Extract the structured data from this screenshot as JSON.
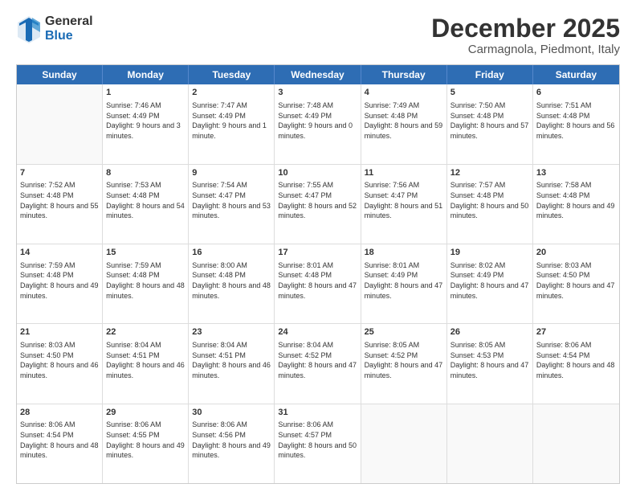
{
  "header": {
    "logo_general": "General",
    "logo_blue": "Blue",
    "month": "December 2025",
    "location": "Carmagnola, Piedmont, Italy"
  },
  "days_of_week": [
    "Sunday",
    "Monday",
    "Tuesday",
    "Wednesday",
    "Thursday",
    "Friday",
    "Saturday"
  ],
  "rows": [
    [
      {
        "day": "",
        "sunrise": "",
        "sunset": "",
        "daylight": "",
        "empty": true
      },
      {
        "day": "1",
        "sunrise": "Sunrise: 7:46 AM",
        "sunset": "Sunset: 4:49 PM",
        "daylight": "Daylight: 9 hours and 3 minutes."
      },
      {
        "day": "2",
        "sunrise": "Sunrise: 7:47 AM",
        "sunset": "Sunset: 4:49 PM",
        "daylight": "Daylight: 9 hours and 1 minute."
      },
      {
        "day": "3",
        "sunrise": "Sunrise: 7:48 AM",
        "sunset": "Sunset: 4:49 PM",
        "daylight": "Daylight: 9 hours and 0 minutes."
      },
      {
        "day": "4",
        "sunrise": "Sunrise: 7:49 AM",
        "sunset": "Sunset: 4:48 PM",
        "daylight": "Daylight: 8 hours and 59 minutes."
      },
      {
        "day": "5",
        "sunrise": "Sunrise: 7:50 AM",
        "sunset": "Sunset: 4:48 PM",
        "daylight": "Daylight: 8 hours and 57 minutes."
      },
      {
        "day": "6",
        "sunrise": "Sunrise: 7:51 AM",
        "sunset": "Sunset: 4:48 PM",
        "daylight": "Daylight: 8 hours and 56 minutes."
      }
    ],
    [
      {
        "day": "7",
        "sunrise": "Sunrise: 7:52 AM",
        "sunset": "Sunset: 4:48 PM",
        "daylight": "Daylight: 8 hours and 55 minutes."
      },
      {
        "day": "8",
        "sunrise": "Sunrise: 7:53 AM",
        "sunset": "Sunset: 4:48 PM",
        "daylight": "Daylight: 8 hours and 54 minutes."
      },
      {
        "day": "9",
        "sunrise": "Sunrise: 7:54 AM",
        "sunset": "Sunset: 4:47 PM",
        "daylight": "Daylight: 8 hours and 53 minutes."
      },
      {
        "day": "10",
        "sunrise": "Sunrise: 7:55 AM",
        "sunset": "Sunset: 4:47 PM",
        "daylight": "Daylight: 8 hours and 52 minutes."
      },
      {
        "day": "11",
        "sunrise": "Sunrise: 7:56 AM",
        "sunset": "Sunset: 4:47 PM",
        "daylight": "Daylight: 8 hours and 51 minutes."
      },
      {
        "day": "12",
        "sunrise": "Sunrise: 7:57 AM",
        "sunset": "Sunset: 4:48 PM",
        "daylight": "Daylight: 8 hours and 50 minutes."
      },
      {
        "day": "13",
        "sunrise": "Sunrise: 7:58 AM",
        "sunset": "Sunset: 4:48 PM",
        "daylight": "Daylight: 8 hours and 49 minutes."
      }
    ],
    [
      {
        "day": "14",
        "sunrise": "Sunrise: 7:59 AM",
        "sunset": "Sunset: 4:48 PM",
        "daylight": "Daylight: 8 hours and 49 minutes."
      },
      {
        "day": "15",
        "sunrise": "Sunrise: 7:59 AM",
        "sunset": "Sunset: 4:48 PM",
        "daylight": "Daylight: 8 hours and 48 minutes."
      },
      {
        "day": "16",
        "sunrise": "Sunrise: 8:00 AM",
        "sunset": "Sunset: 4:48 PM",
        "daylight": "Daylight: 8 hours and 48 minutes."
      },
      {
        "day": "17",
        "sunrise": "Sunrise: 8:01 AM",
        "sunset": "Sunset: 4:48 PM",
        "daylight": "Daylight: 8 hours and 47 minutes."
      },
      {
        "day": "18",
        "sunrise": "Sunrise: 8:01 AM",
        "sunset": "Sunset: 4:49 PM",
        "daylight": "Daylight: 8 hours and 47 minutes."
      },
      {
        "day": "19",
        "sunrise": "Sunrise: 8:02 AM",
        "sunset": "Sunset: 4:49 PM",
        "daylight": "Daylight: 8 hours and 47 minutes."
      },
      {
        "day": "20",
        "sunrise": "Sunrise: 8:03 AM",
        "sunset": "Sunset: 4:50 PM",
        "daylight": "Daylight: 8 hours and 47 minutes."
      }
    ],
    [
      {
        "day": "21",
        "sunrise": "Sunrise: 8:03 AM",
        "sunset": "Sunset: 4:50 PM",
        "daylight": "Daylight: 8 hours and 46 minutes."
      },
      {
        "day": "22",
        "sunrise": "Sunrise: 8:04 AM",
        "sunset": "Sunset: 4:51 PM",
        "daylight": "Daylight: 8 hours and 46 minutes."
      },
      {
        "day": "23",
        "sunrise": "Sunrise: 8:04 AM",
        "sunset": "Sunset: 4:51 PM",
        "daylight": "Daylight: 8 hours and 46 minutes."
      },
      {
        "day": "24",
        "sunrise": "Sunrise: 8:04 AM",
        "sunset": "Sunset: 4:52 PM",
        "daylight": "Daylight: 8 hours and 47 minutes."
      },
      {
        "day": "25",
        "sunrise": "Sunrise: 8:05 AM",
        "sunset": "Sunset: 4:52 PM",
        "daylight": "Daylight: 8 hours and 47 minutes."
      },
      {
        "day": "26",
        "sunrise": "Sunrise: 8:05 AM",
        "sunset": "Sunset: 4:53 PM",
        "daylight": "Daylight: 8 hours and 47 minutes."
      },
      {
        "day": "27",
        "sunrise": "Sunrise: 8:06 AM",
        "sunset": "Sunset: 4:54 PM",
        "daylight": "Daylight: 8 hours and 48 minutes."
      }
    ],
    [
      {
        "day": "28",
        "sunrise": "Sunrise: 8:06 AM",
        "sunset": "Sunset: 4:54 PM",
        "daylight": "Daylight: 8 hours and 48 minutes."
      },
      {
        "day": "29",
        "sunrise": "Sunrise: 8:06 AM",
        "sunset": "Sunset: 4:55 PM",
        "daylight": "Daylight: 8 hours and 49 minutes."
      },
      {
        "day": "30",
        "sunrise": "Sunrise: 8:06 AM",
        "sunset": "Sunset: 4:56 PM",
        "daylight": "Daylight: 8 hours and 49 minutes."
      },
      {
        "day": "31",
        "sunrise": "Sunrise: 8:06 AM",
        "sunset": "Sunset: 4:57 PM",
        "daylight": "Daylight: 8 hours and 50 minutes."
      },
      {
        "day": "",
        "sunrise": "",
        "sunset": "",
        "daylight": "",
        "empty": true
      },
      {
        "day": "",
        "sunrise": "",
        "sunset": "",
        "daylight": "",
        "empty": true
      },
      {
        "day": "",
        "sunrise": "",
        "sunset": "",
        "daylight": "",
        "empty": true
      }
    ]
  ]
}
